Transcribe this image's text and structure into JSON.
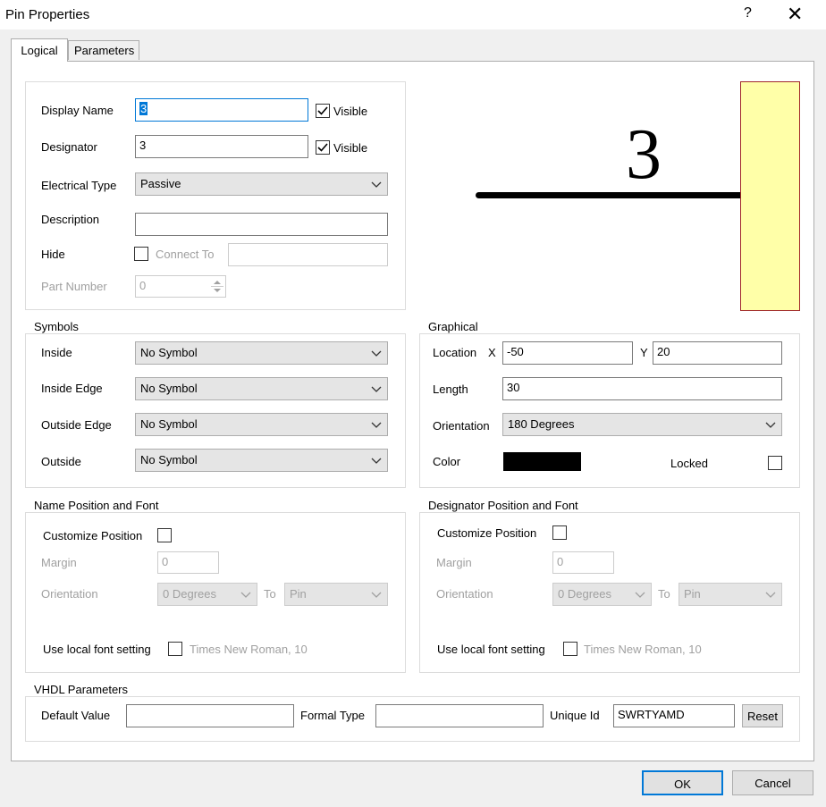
{
  "window": {
    "title": "Pin Properties",
    "help_glyph": "?",
    "close_glyph": "✕"
  },
  "tabs": [
    "Logical",
    "Parameters"
  ],
  "properties": {
    "display_name_label": "Display Name",
    "display_name_value": "3",
    "display_name_visible_label": "Visible",
    "designator_label": "Designator",
    "designator_value": "3",
    "designator_visible_label": "Visible",
    "electrical_type_label": "Electrical Type",
    "electrical_type_value": "Passive",
    "description_label": "Description",
    "description_value": "",
    "hide_label": "Hide",
    "connect_to_label": "Connect To",
    "connect_to_value": "",
    "part_number_label": "Part Number",
    "part_number_value": "0"
  },
  "preview": {
    "pin_label": "3",
    "body_color": "#ffffa8",
    "body_border": "#a0282a"
  },
  "symbols": {
    "title": "Symbols",
    "inside_label": "Inside",
    "inside_value": "No Symbol",
    "inside_edge_label": "Inside Edge",
    "inside_edge_value": "No Symbol",
    "outside_edge_label": "Outside Edge",
    "outside_edge_value": "No Symbol",
    "outside_label": "Outside",
    "outside_value": "No Symbol"
  },
  "graphical": {
    "title": "Graphical",
    "location_label": "Location",
    "x_label": "X",
    "x_value": "-50",
    "y_label": "Y",
    "y_value": "20",
    "length_label": "Length",
    "length_value": "30",
    "orientation_label": "Orientation",
    "orientation_value": "180 Degrees",
    "color_label": "Color",
    "color_value": "#000000",
    "locked_label": "Locked"
  },
  "name_position": {
    "title": "Name Position and Font",
    "customize_label": "Customize Position",
    "margin_label": "Margin",
    "margin_value": "0",
    "orientation_label": "Orientation",
    "orientation_value": "0 Degrees",
    "to_label": "To",
    "to_value": "Pin",
    "font_label": "Use local font setting",
    "font_value": "Times New Roman, 10"
  },
  "designator_position": {
    "title": "Designator Position and Font",
    "customize_label": "Customize Position",
    "margin_label": "Margin",
    "margin_value": "0",
    "orientation_label": "Orientation",
    "orientation_value": "0 Degrees",
    "to_label": "To",
    "to_value": "Pin",
    "font_label": "Use local font setting",
    "font_value": "Times New Roman, 10"
  },
  "vhdl": {
    "title": "VHDL Parameters",
    "default_value_label": "Default Value",
    "default_value": "",
    "formal_type_label": "Formal Type",
    "formal_type": "",
    "unique_id_label": "Unique Id",
    "unique_id": "SWRTYAMD",
    "reset_label": "Reset"
  },
  "buttons": {
    "ok": "OK",
    "cancel": "Cancel"
  }
}
